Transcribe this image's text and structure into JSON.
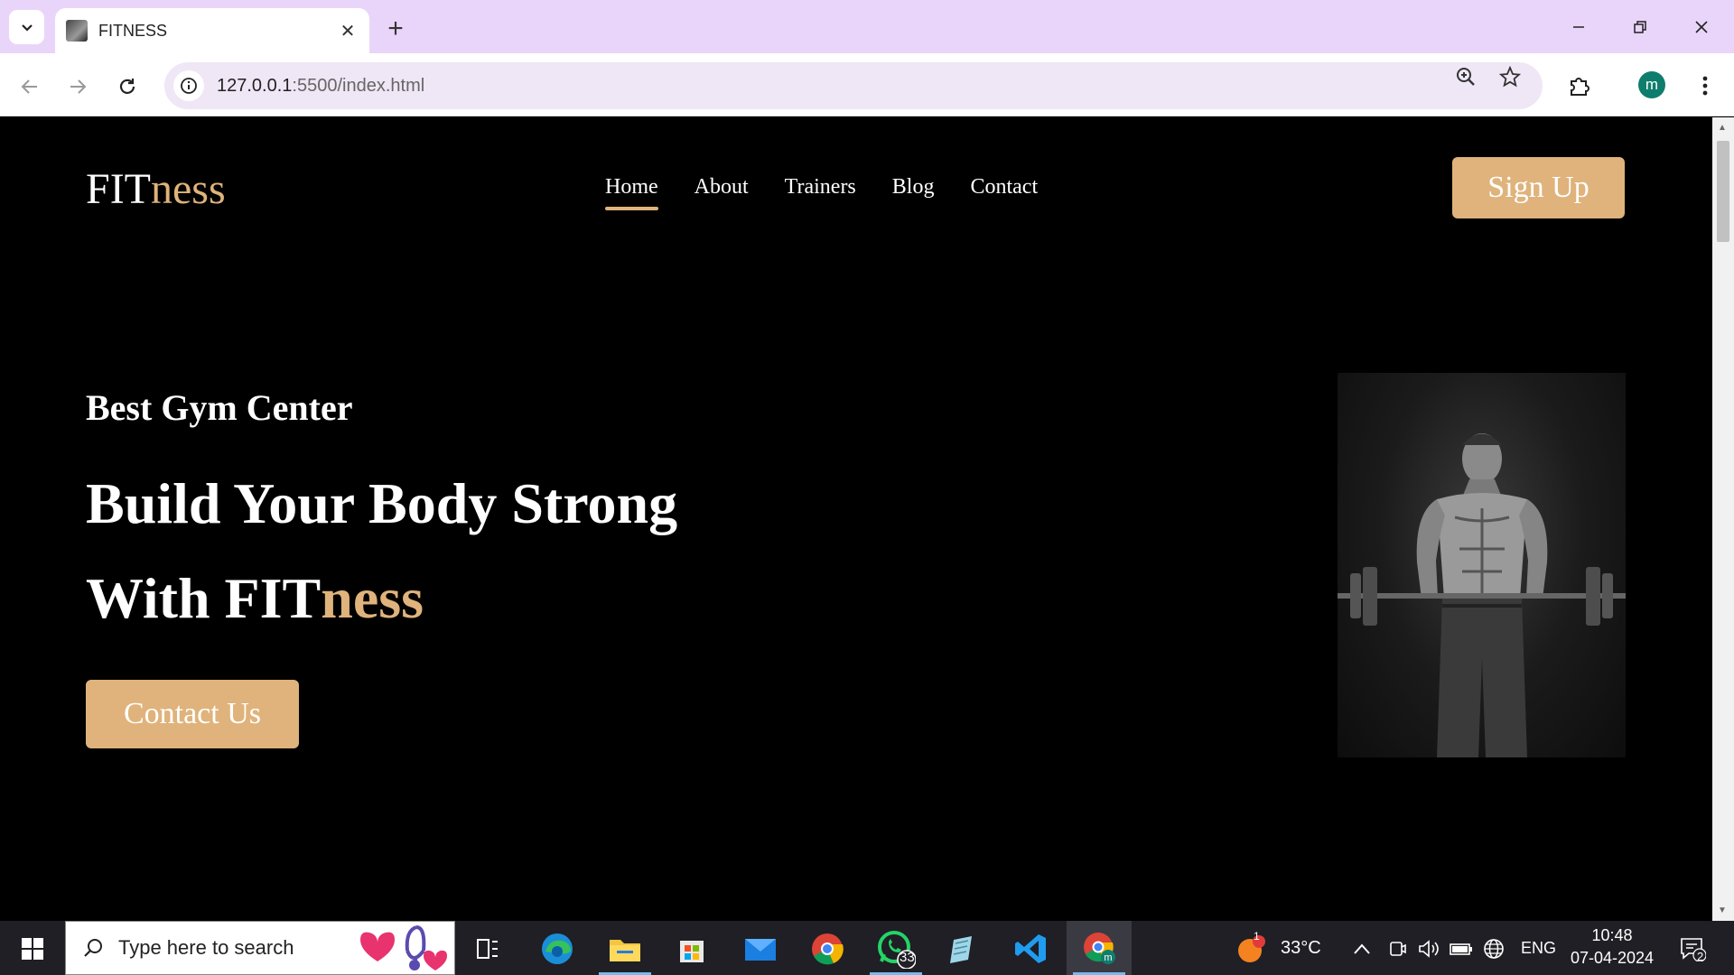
{
  "browser": {
    "tab_title": "FITNESS",
    "url_host": "127.0.0.1",
    "url_rest": ":5500/index.html",
    "profile_initial": "m"
  },
  "site": {
    "logo_main": "FIT",
    "logo_accent": "ness",
    "nav": [
      "Home",
      "About",
      "Trainers",
      "Blog",
      "Contact"
    ],
    "active_nav": "Home",
    "signup_label": "Sign Up",
    "eyebrow": "Best Gym Center",
    "headline_line1": "Build Your Body Strong",
    "headline_line2_prefix": "With ",
    "headline_line2_main": "FIT",
    "headline_line2_accent": "ness",
    "contact_label": "Contact Us",
    "accent_color": "#dfb37b"
  },
  "taskbar": {
    "search_placeholder": "Type here to search",
    "whatsapp_badge": "33",
    "weather_badge": "1",
    "temperature": "33°C",
    "language": "ENG",
    "time": "10:48",
    "date": "07-04-2024",
    "notifications": "2"
  }
}
